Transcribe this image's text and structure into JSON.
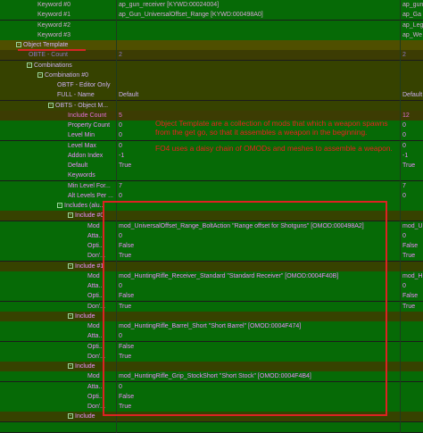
{
  "tree": [
    {
      "name": "Keyword #0",
      "value": "ap_gun_receiver [KYWD:00024004]",
      "ext": "ap_gun",
      "bg": "#066a06",
      "fg": "#d6a7d6",
      "vfg": "#d6a7d6",
      "indent": 42,
      "toggle": ""
    },
    {
      "name": "Keyword #1",
      "value": "ap_Gun_UniversalOffset_Range [KYWD:000498A0]",
      "ext": "ap_Ga",
      "bg": "#066a06",
      "fg": "#d6a7d6",
      "vfg": "#d6a7d6",
      "indent": 42,
      "toggle": ""
    },
    {
      "name": "Keyword #2",
      "value": "",
      "ext": "ap_Leg",
      "bg": "#066a06",
      "fg": "#d6a7d6",
      "vfg": "#d6a7d6",
      "indent": 42,
      "toggle": ""
    },
    {
      "name": "Keyword #3",
      "value": "",
      "ext": "ap_We",
      "bg": "#066a06",
      "fg": "#d6a7d6",
      "vfg": "#d6a7d6",
      "indent": 42,
      "toggle": ""
    },
    {
      "name": "Object Template",
      "value": "",
      "ext": "",
      "bg": "#4f4f00",
      "fg": "#d8b6ff",
      "vfg": "#d8b6ff",
      "indent": 18,
      "toggle": "-"
    },
    {
      "name": "OBTE - Count",
      "value": "2",
      "ext": "2",
      "bg": "#3c3c03",
      "fg": "#8c77c4",
      "vfg": "#8c77c4",
      "indent": 32,
      "toggle": ""
    },
    {
      "name": "Combinations",
      "value": "",
      "ext": "",
      "bg": "#364200",
      "fg": "#cdb0f0",
      "vfg": "#cdb0f0",
      "indent": 30,
      "toggle": "-"
    },
    {
      "name": "Combination #0",
      "value": "",
      "ext": "",
      "bg": "#364200",
      "fg": "#cdb0f0",
      "vfg": "#cdb0f0",
      "indent": 42,
      "toggle": "-"
    },
    {
      "name": "OBTF - Editor Only",
      "value": "",
      "ext": "",
      "bg": "#364200",
      "fg": "#cdb0f0",
      "vfg": "#cdb0f0",
      "indent": 64,
      "toggle": ""
    },
    {
      "name": "FULL - Name",
      "value": "Default",
      "ext": "Default",
      "bg": "#364200",
      "fg": "#cdb0f0",
      "vfg": "#cdb0f0",
      "indent": 64,
      "toggle": ""
    },
    {
      "name": "OBTS - Object M...",
      "value": "",
      "ext": "",
      "bg": "#364200",
      "fg": "#cdb0f0",
      "vfg": "#cdb0f0",
      "indent": 54,
      "toggle": "-"
    },
    {
      "name": "Include Count",
      "value": "5",
      "ext": "12",
      "bg": "#3c3c03",
      "fg": "#e36fd7",
      "vfg": "#e36fd7",
      "indent": 76,
      "toggle": ""
    },
    {
      "name": "Property Count",
      "value": "0",
      "ext": "0",
      "bg": "#066a06",
      "fg": "#ee8cff",
      "vfg": "#ee8cff",
      "indent": 76,
      "toggle": ""
    },
    {
      "name": "Level Min",
      "value": "0",
      "ext": "0",
      "bg": "#066a06",
      "fg": "#ee8cff",
      "vfg": "#ee8cff",
      "indent": 76,
      "toggle": ""
    },
    {
      "name": "Level Max",
      "value": "0",
      "ext": "0",
      "bg": "#066a06",
      "fg": "#ee8cff",
      "vfg": "#ee8cff",
      "indent": 76,
      "toggle": ""
    },
    {
      "name": "Addon Index",
      "value": "-1",
      "ext": "-1",
      "bg": "#066a06",
      "fg": "#ee8cff",
      "vfg": "#ee8cff",
      "indent": 76,
      "toggle": ""
    },
    {
      "name": "Default",
      "value": "True",
      "ext": "True",
      "bg": "#066a06",
      "fg": "#ee8cff",
      "vfg": "#ee8cff",
      "indent": 76,
      "toggle": ""
    },
    {
      "name": "Keywords",
      "value": "",
      "ext": "",
      "bg": "#066a06",
      "fg": "#ee8cff",
      "vfg": "#ee8cff",
      "indent": 76,
      "toggle": ""
    },
    {
      "name": "Min Level For...",
      "value": "7",
      "ext": "7",
      "bg": "#066a06",
      "fg": "#ee8cff",
      "vfg": "#ee8cff",
      "indent": 76,
      "toggle": ""
    },
    {
      "name": "Alt Levels Per ...",
      "value": "0",
      "ext": "0",
      "bg": "#066a06",
      "fg": "#ee8cff",
      "vfg": "#ee8cff",
      "indent": 76,
      "toggle": ""
    },
    {
      "name": "Includes (alu...",
      "value": "",
      "ext": "",
      "bg": "#066a06",
      "fg": "#ee8cff",
      "vfg": "#ee8cff",
      "indent": 64,
      "toggle": "-"
    },
    {
      "name": "Include #0",
      "value": "",
      "ext": "",
      "bg": "#364200",
      "fg": "#ee8cff",
      "vfg": "#ee8cff",
      "indent": 76,
      "toggle": "-"
    },
    {
      "name": "Mod",
      "value": "mod_UniversalOffset_Range_BoltAction \"Range offset for Shotguns\" [OMOD:000498A2]",
      "ext": "mod_U",
      "bg": "#066a06",
      "fg": "#ee8cff",
      "vfg": "#ee8cff",
      "indent": 98,
      "toggle": ""
    },
    {
      "name": "Atta...",
      "value": "0",
      "ext": "0",
      "bg": "#066a06",
      "fg": "#ee8cff",
      "vfg": "#ee8cff",
      "indent": 98,
      "toggle": ""
    },
    {
      "name": "Opti...",
      "value": "False",
      "ext": "False",
      "bg": "#066a06",
      "fg": "#ee8cff",
      "vfg": "#ee8cff",
      "indent": 98,
      "toggle": ""
    },
    {
      "name": "Don'...",
      "value": "True",
      "ext": "True",
      "bg": "#066a06",
      "fg": "#ee8cff",
      "vfg": "#ee8cff",
      "indent": 98,
      "toggle": ""
    },
    {
      "name": "Include #1",
      "value": "",
      "ext": "",
      "bg": "#364200",
      "fg": "#ee8cff",
      "vfg": "#ee8cff",
      "indent": 76,
      "toggle": "-"
    },
    {
      "name": "Mod",
      "value": "mod_HuntingRifle_Receiver_Standard \"Standard Receiver\" [OMOD:0004F40B]",
      "ext": "mod_H",
      "bg": "#066a06",
      "fg": "#ee8cff",
      "vfg": "#ee8cff",
      "indent": 98,
      "toggle": ""
    },
    {
      "name": "Atta...",
      "value": "0",
      "ext": "0",
      "bg": "#066a06",
      "fg": "#ee8cff",
      "vfg": "#ee8cff",
      "indent": 98,
      "toggle": ""
    },
    {
      "name": "Opti...",
      "value": "False",
      "ext": "False",
      "bg": "#066a06",
      "fg": "#ee8cff",
      "vfg": "#ee8cff",
      "indent": 98,
      "toggle": ""
    },
    {
      "name": "Don'...",
      "value": "True",
      "ext": "True",
      "bg": "#066a06",
      "fg": "#ee8cff",
      "vfg": "#ee8cff",
      "indent": 98,
      "toggle": ""
    },
    {
      "name": "Include",
      "value": "",
      "ext": "",
      "bg": "#364200",
      "fg": "#ee8cff",
      "vfg": "#ee8cff",
      "indent": 76,
      "toggle": "-"
    },
    {
      "name": "Mod",
      "value": "mod_HuntingRifle_Barrel_Short \"Short Barrel\" [OMOD:0004F474]",
      "ext": "",
      "bg": "#066a06",
      "fg": "#ee8cff",
      "vfg": "#ee8cff",
      "indent": 98,
      "toggle": ""
    },
    {
      "name": "Atta...",
      "value": "0",
      "ext": "",
      "bg": "#066a06",
      "fg": "#ee8cff",
      "vfg": "#ee8cff",
      "indent": 98,
      "toggle": ""
    },
    {
      "name": "Opti...",
      "value": "False",
      "ext": "",
      "bg": "#066a06",
      "fg": "#ee8cff",
      "vfg": "#ee8cff",
      "indent": 98,
      "toggle": ""
    },
    {
      "name": "Don'...",
      "value": "True",
      "ext": "",
      "bg": "#066a06",
      "fg": "#ee8cff",
      "vfg": "#ee8cff",
      "indent": 98,
      "toggle": ""
    },
    {
      "name": "Include",
      "value": "",
      "ext": "",
      "bg": "#364200",
      "fg": "#ee8cff",
      "vfg": "#ee8cff",
      "indent": 76,
      "toggle": "-"
    },
    {
      "name": "Mod",
      "value": "mod_HuntingRifle_Grip_StockShort \"Short Stock\" [OMOD:0004F4B4]",
      "ext": "",
      "bg": "#066a06",
      "fg": "#ee8cff",
      "vfg": "#ee8cff",
      "indent": 98,
      "toggle": ""
    },
    {
      "name": "Atta...",
      "value": "0",
      "ext": "",
      "bg": "#066a06",
      "fg": "#ee8cff",
      "vfg": "#ee8cff",
      "indent": 98,
      "toggle": ""
    },
    {
      "name": "Opti...",
      "value": "False",
      "ext": "",
      "bg": "#066a06",
      "fg": "#ee8cff",
      "vfg": "#ee8cff",
      "indent": 98,
      "toggle": ""
    },
    {
      "name": "Don'...",
      "value": "True",
      "ext": "",
      "bg": "#066a06",
      "fg": "#ee8cff",
      "vfg": "#ee8cff",
      "indent": 98,
      "toggle": ""
    },
    {
      "name": "Include",
      "value": "",
      "ext": "",
      "bg": "#364200",
      "fg": "#ee8cff",
      "vfg": "#ee8cff",
      "indent": 76,
      "toggle": "-"
    },
    {
      "name": "",
      "value": "",
      "ext": "",
      "bg": "#066a06",
      "fg": "#ee8cff",
      "vfg": "#ee8cff",
      "indent": 76,
      "toggle": ""
    }
  ],
  "annotation": {
    "note_lines": [
      "Object Template are a collection of mods that which a weapon spawns from the get go, so that it assembles a weapon in the beginning.",
      "FO4 uses a daisy chain of OMODs and meshes to assemble a weapon."
    ],
    "color": "#dd2222"
  }
}
